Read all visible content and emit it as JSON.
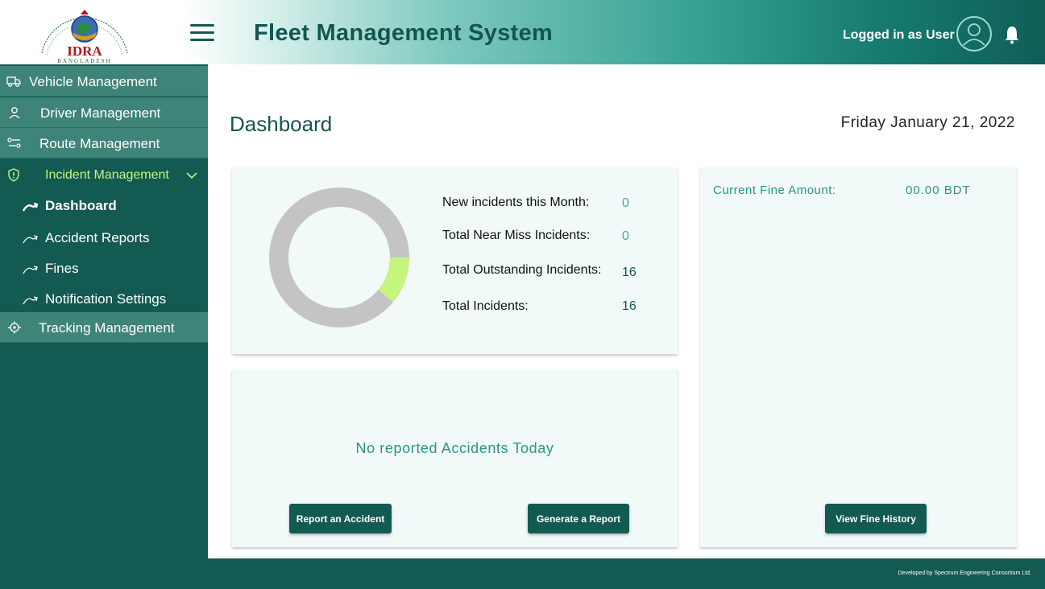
{
  "header": {
    "logo_text": "IDRA",
    "logo_sub": "BANGLADESH",
    "logo_ring_text": "INSURANCE DEVELOPMENT AND REGULATORY AUTHORITY",
    "title": "Fleet Management System",
    "user_label": "Logged in as User",
    "icons": {
      "menu": "hamburger-icon",
      "avatar": "user-avatar-icon",
      "notifications": "bell-icon"
    }
  },
  "sidebar": {
    "items": [
      {
        "label": "Vehicle Management",
        "icon": "truck-icon"
      },
      {
        "label": "Driver Management",
        "icon": "person-icon"
      },
      {
        "label": "Route Management",
        "icon": "route-icon"
      }
    ],
    "incident": {
      "label": "Incident Management",
      "icon": "shield-alert-icon",
      "expanded": true,
      "subitems": [
        {
          "label": "Dashboard",
          "active": true
        },
        {
          "label": "Accident Reports"
        },
        {
          "label": "Fines"
        },
        {
          "label": "Notification Settings"
        }
      ]
    },
    "tracking": {
      "label": "Tracking Management",
      "icon": "target-icon"
    }
  },
  "main": {
    "title": "Dashboard",
    "date": "Friday January 21, 2022",
    "stats": [
      {
        "label": "New incidents this Month:",
        "value": "0"
      },
      {
        "label": "Total Near Miss Incidents:",
        "value": "0"
      },
      {
        "label": "Total Outstanding Incidents:",
        "value": "16"
      },
      {
        "label": "Total Incidents:",
        "value": "16"
      }
    ],
    "donut": {
      "highlight_fraction": 0.11,
      "ring_color": "#c4c4c4",
      "highlight_color": "#c6f57e"
    },
    "accidents": {
      "message": "No reported Accidents Today",
      "report_button": "Report an Accident",
      "generate_button": "Generate a Report"
    },
    "fine": {
      "label": "Current Fine Amount:",
      "value": "00.00 BDT",
      "history_button": "View Fine History"
    }
  },
  "footer": {
    "text": "Developed by Spectrum Engineering Consortium Ltd."
  },
  "colors": {
    "primary": "#135a52",
    "accent": "#c6f57e",
    "teal_text": "#2a9486",
    "nav_item_bg": "#3e8478"
  }
}
